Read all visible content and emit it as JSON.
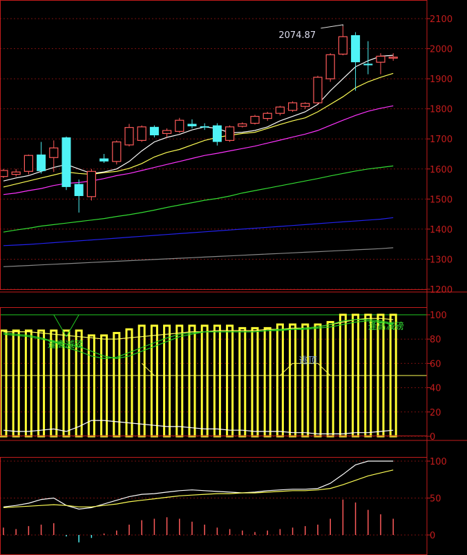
{
  "colors": {
    "background": "#000000",
    "frame": "#c41c1c",
    "grid": "#7a1010",
    "up_candle": "#ff5a5a",
    "down_candle": "#4ff3f6",
    "ma5": "#ffffff",
    "ma10": "#ffff55",
    "ma20": "#ff33ff",
    "ma60": "#33dd33",
    "ma120": "#2222ee",
    "ma250": "#888888",
    "osc_bar": "#ffff33",
    "osc_green": "#22cc22",
    "annotation_green": "#33dd33",
    "annotation_blue": "#88aadd",
    "sig_bar": "#ff5a5a",
    "sig_down": "#4ff3f6"
  },
  "chart_data": [
    {
      "type": "candlestick",
      "panel": "price",
      "y_ticks": [
        "1200",
        "1300",
        "1400",
        "1500",
        "1600",
        "1700",
        "1800",
        "1900",
        "2000",
        "2100"
      ],
      "ylim": [
        1200,
        2110
      ],
      "grid": true,
      "annotation": "2074.87",
      "candles": [
        {
          "o": 1575,
          "h": 1600,
          "l": 1570,
          "c": 1595
        },
        {
          "o": 1582,
          "h": 1600,
          "l": 1575,
          "c": 1590
        },
        {
          "o": 1592,
          "h": 1648,
          "l": 1582,
          "c": 1645
        },
        {
          "o": 1648,
          "h": 1690,
          "l": 1585,
          "c": 1593
        },
        {
          "o": 1638,
          "h": 1695,
          "l": 1590,
          "c": 1670
        },
        {
          "o": 1705,
          "h": 1708,
          "l": 1530,
          "c": 1540
        },
        {
          "o": 1550,
          "h": 1565,
          "l": 1455,
          "c": 1510
        },
        {
          "o": 1508,
          "h": 1600,
          "l": 1495,
          "c": 1592
        },
        {
          "o": 1635,
          "h": 1650,
          "l": 1620,
          "c": 1625
        },
        {
          "o": 1625,
          "h": 1695,
          "l": 1615,
          "c": 1690
        },
        {
          "o": 1680,
          "h": 1750,
          "l": 1675,
          "c": 1738
        },
        {
          "o": 1695,
          "h": 1745,
          "l": 1690,
          "c": 1740
        },
        {
          "o": 1740,
          "h": 1745,
          "l": 1705,
          "c": 1712
        },
        {
          "o": 1718,
          "h": 1735,
          "l": 1705,
          "c": 1728
        },
        {
          "o": 1725,
          "h": 1770,
          "l": 1720,
          "c": 1762
        },
        {
          "o": 1750,
          "h": 1765,
          "l": 1735,
          "c": 1742
        },
        {
          "o": 1742,
          "h": 1752,
          "l": 1730,
          "c": 1738
        },
        {
          "o": 1745,
          "h": 1752,
          "l": 1678,
          "c": 1690
        },
        {
          "o": 1695,
          "h": 1745,
          "l": 1690,
          "c": 1740
        },
        {
          "o": 1742,
          "h": 1755,
          "l": 1738,
          "c": 1750
        },
        {
          "o": 1752,
          "h": 1780,
          "l": 1748,
          "c": 1775
        },
        {
          "o": 1768,
          "h": 1790,
          "l": 1760,
          "c": 1785
        },
        {
          "o": 1785,
          "h": 1810,
          "l": 1778,
          "c": 1806
        },
        {
          "o": 1795,
          "h": 1825,
          "l": 1790,
          "c": 1820
        },
        {
          "o": 1808,
          "h": 1822,
          "l": 1800,
          "c": 1818
        },
        {
          "o": 1820,
          "h": 1910,
          "l": 1815,
          "c": 1905
        },
        {
          "o": 1900,
          "h": 1985,
          "l": 1890,
          "c": 1980
        },
        {
          "o": 1982,
          "h": 2075,
          "l": 1978,
          "c": 2040
        },
        {
          "o": 2045,
          "h": 2055,
          "l": 1860,
          "c": 1955
        },
        {
          "o": 1950,
          "h": 2025,
          "l": 1915,
          "c": 1945
        },
        {
          "o": 1955,
          "h": 1985,
          "l": 1915,
          "c": 1975
        },
        {
          "o": 1970,
          "h": 1985,
          "l": 1960,
          "c": 1972
        }
      ],
      "series": [
        {
          "key": "ma5",
          "values": [
            1560,
            1570,
            1578,
            1592,
            1605,
            1615,
            1600,
            1585,
            1590,
            1600,
            1625,
            1660,
            1690,
            1705,
            1715,
            1730,
            1740,
            1735,
            1720,
            1722,
            1728,
            1740,
            1760,
            1775,
            1790,
            1815,
            1860,
            1900,
            1940,
            1960,
            1975,
            1978
          ]
        },
        {
          "key": "ma10",
          "values": [
            1540,
            1550,
            1560,
            1570,
            1580,
            1590,
            1585,
            1582,
            1588,
            1592,
            1602,
            1618,
            1640,
            1655,
            1665,
            1680,
            1695,
            1705,
            1712,
            1718,
            1722,
            1735,
            1748,
            1760,
            1770,
            1790,
            1815,
            1840,
            1870,
            1890,
            1905,
            1918
          ]
        },
        {
          "key": "ma20",
          "values": [
            1515,
            1520,
            1528,
            1535,
            1545,
            1552,
            1555,
            1560,
            1568,
            1578,
            1585,
            1595,
            1605,
            1615,
            1625,
            1635,
            1645,
            1652,
            1660,
            1668,
            1676,
            1686,
            1696,
            1706,
            1716,
            1728,
            1745,
            1762,
            1778,
            1792,
            1802,
            1810
          ]
        },
        {
          "key": "ma60",
          "values": [
            1390,
            1397,
            1403,
            1410,
            1415,
            1420,
            1425,
            1430,
            1435,
            1442,
            1448,
            1455,
            1463,
            1472,
            1480,
            1488,
            1496,
            1502,
            1510,
            1520,
            1528,
            1536,
            1544,
            1552,
            1560,
            1568,
            1577,
            1585,
            1593,
            1600,
            1605,
            1610
          ]
        },
        {
          "key": "ma120",
          "values": [
            1345,
            1347,
            1349,
            1352,
            1355,
            1358,
            1361,
            1364,
            1367,
            1370,
            1373,
            1376,
            1379,
            1382,
            1385,
            1388,
            1391,
            1394,
            1397,
            1400,
            1403,
            1406,
            1409,
            1412,
            1415,
            1418,
            1421,
            1424,
            1427,
            1430,
            1433,
            1438
          ]
        },
        {
          "key": "ma250",
          "values": [
            1275,
            1277,
            1279,
            1281,
            1283,
            1285,
            1287,
            1289,
            1291,
            1293,
            1295,
            1297,
            1299,
            1301,
            1303,
            1305,
            1307,
            1309,
            1311,
            1313,
            1315,
            1317,
            1319,
            1321,
            1323,
            1325,
            1327,
            1329,
            1331,
            1333,
            1335,
            1338
          ]
        }
      ]
    },
    {
      "type": "bar",
      "panel": "oscillator",
      "y_ticks": [
        "0",
        "20",
        "40",
        "60",
        "80",
        "100"
      ],
      "ylim": [
        0,
        105
      ],
      "grid": true,
      "annotations": [
        {
          "text": "逢高减磅",
          "x_index": 3.5,
          "y": 73,
          "color_key": "annotation_green"
        },
        {
          "text": "逃顶",
          "x_index": 23.5,
          "y": 60,
          "color_key": "annotation_blue"
        },
        {
          "text": "逢高减磅",
          "x_index": 29.0,
          "y": 88,
          "color_key": "annotation_green"
        }
      ],
      "values": [
        87,
        87,
        87,
        87,
        87,
        87,
        87,
        83,
        83,
        85,
        88,
        91,
        91,
        91,
        91,
        91,
        91,
        91,
        91,
        89,
        89,
        89,
        92,
        92,
        92,
        92,
        94,
        100,
        100,
        100,
        100,
        100
      ],
      "series": [
        {
          "key": "ma10",
          "values": [
            86,
            86,
            86,
            85,
            84,
            83,
            82,
            81,
            80,
            80,
            81,
            82,
            83,
            84,
            85,
            86,
            86,
            87,
            87,
            87,
            87,
            88,
            88,
            89,
            89,
            90,
            92,
            94,
            96,
            97,
            97,
            96
          ]
        },
        {
          "key": "osc_green",
          "values": [
            84,
            83,
            82,
            80,
            78,
            76,
            74,
            70,
            66,
            64,
            66,
            70,
            74,
            78,
            82,
            84,
            86,
            86,
            86,
            86,
            86,
            87,
            87,
            88,
            88,
            89,
            90,
            92,
            94,
            95,
            94,
            92
          ]
        },
        {
          "key": "osc_green",
          "values": [
            85,
            84,
            83,
            81,
            78,
            73,
            70,
            66,
            64,
            65,
            69,
            73,
            77,
            81,
            84,
            85,
            86,
            86,
            86,
            86,
            86,
            87,
            88,
            88,
            89,
            90,
            92,
            95,
            96,
            96,
            95,
            93
          ]
        },
        {
          "key": "ma5",
          "values": [
            5,
            4,
            4,
            5,
            6,
            4,
            8,
            13,
            13,
            12,
            11,
            10,
            9,
            8,
            8,
            7,
            6,
            6,
            5,
            5,
            4,
            4,
            4,
            3,
            3,
            2,
            2,
            2,
            3,
            3,
            4,
            5
          ]
        }
      ]
    },
    {
      "type": "line",
      "panel": "indicator",
      "y_ticks": [
        "0",
        "50",
        "100"
      ],
      "ylim": [
        -12,
        110
      ],
      "grid": true,
      "series": [
        {
          "key": "ma5",
          "values": [
            38,
            40,
            43,
            48,
            50,
            40,
            35,
            37,
            42,
            47,
            52,
            55,
            56,
            58,
            60,
            61,
            60,
            59,
            58,
            57,
            58,
            60,
            61,
            62,
            62,
            63,
            70,
            82,
            95,
            100,
            100,
            100
          ]
        },
        {
          "key": "ma10",
          "values": [
            37,
            38,
            39,
            40,
            41,
            40,
            38,
            38,
            40,
            42,
            45,
            47,
            49,
            51,
            53,
            54,
            55,
            56,
            56,
            57,
            57,
            58,
            59,
            60,
            60,
            61,
            63,
            68,
            74,
            80,
            84,
            88
          ]
        }
      ],
      "bars": [
        10,
        8,
        12,
        14,
        16,
        -2,
        -10,
        -4,
        2,
        6,
        14,
        20,
        22,
        24,
        22,
        18,
        14,
        10,
        8,
        6,
        4,
        6,
        8,
        10,
        12,
        14,
        22,
        48,
        44,
        34,
        28,
        22
      ]
    }
  ]
}
